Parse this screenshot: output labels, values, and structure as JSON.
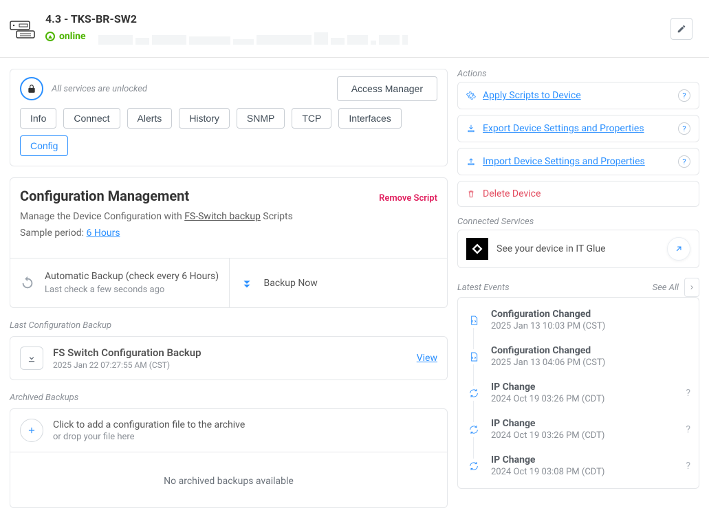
{
  "header": {
    "title": "4.3 - TKS-BR-SW2",
    "status": "online"
  },
  "lockbar": {
    "text": "All services are unlocked",
    "access_manager": "Access Manager"
  },
  "tabs": [
    "Info",
    "Connect",
    "Alerts",
    "History",
    "SNMP",
    "TCP",
    "Interfaces",
    "Config"
  ],
  "config": {
    "title": "Configuration Management",
    "remove": "Remove Script",
    "subtitle_pre": "Manage the Device Configuration with ",
    "subtitle_link": "FS-Switch backup",
    "subtitle_post": " Scripts",
    "sample_label": "Sample period: ",
    "sample_value": "6 Hours",
    "panel1_title": "Automatic Backup (check every 6 Hours)",
    "panel1_sub": "Last check a few seconds ago",
    "panel2_title": "Backup Now"
  },
  "last_backup_label": "Last Configuration Backup",
  "backup": {
    "title": "FS Switch Configuration Backup",
    "date": "2025 Jan 22 07:27:55 AM (CST)",
    "view": "View"
  },
  "archive": {
    "label": "Archived Backups",
    "add_line1": "Click to add a configuration file to the archive",
    "add_line2": "or drop your file here",
    "none": "No archived backups available"
  },
  "actions": {
    "label": "Actions",
    "items": [
      {
        "label": "Apply Scripts to Device",
        "style": "blue"
      },
      {
        "label": "Export Device Settings and Properties",
        "style": "blue"
      },
      {
        "label": "Import Device Settings and Properties",
        "style": "blue"
      },
      {
        "label": "Delete Device",
        "style": "red"
      }
    ]
  },
  "connected": {
    "label": "Connected Services",
    "text": "See your device in IT Glue"
  },
  "events": {
    "label": "Latest Events",
    "see_all": "See All",
    "items": [
      {
        "title": "Configuration Changed",
        "date": "2025 Jan 13 10:03 PM (CST)",
        "icon": "doc",
        "q": false
      },
      {
        "title": "Configuration Changed",
        "date": "2025 Jan 13 04:06 PM (CST)",
        "icon": "doc",
        "q": false
      },
      {
        "title": "IP Change",
        "date": "2024 Oct 19 03:26 PM (CDT)",
        "icon": "sync",
        "q": true
      },
      {
        "title": "IP Change",
        "date": "2024 Oct 19 03:26 PM (CDT)",
        "icon": "sync",
        "q": true
      },
      {
        "title": "IP Change",
        "date": "2024 Oct 19 03:08 PM (CDT)",
        "icon": "sync",
        "q": true
      }
    ]
  }
}
